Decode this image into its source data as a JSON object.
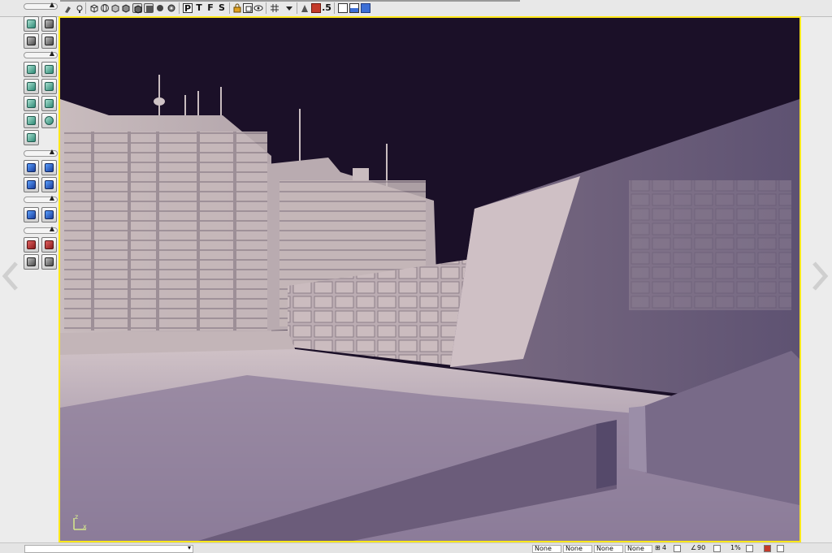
{
  "toolbar": {
    "letters": [
      "P",
      "T",
      "F",
      "S"
    ],
    "realtime_suffix": ".5",
    "icons": [
      "brush-icon",
      "lightbulb-icon",
      "wireframe-cube-icon",
      "wireframe-sphere-icon",
      "solid-cube-icon",
      "textured-cube-icon",
      "lit-cube-icon",
      "dynamic-lit-icon",
      "unlit-icon",
      "lock-icon",
      "viewport-select-icon",
      "eye-icon",
      "grid-icon",
      "dropdown-arrow-icon",
      "actor-icon",
      "realtime-preview-icon",
      "single-view-icon",
      "split-view-icon",
      "maximize-view-icon"
    ]
  },
  "tool_panel": {
    "groups": [
      {
        "tools": [
          "camera-mode-icon",
          "cube-icon",
          "terrain-icon",
          "move-axis-icon"
        ]
      },
      {
        "tools": [
          "cube-builder-icon",
          "cone-builder-icon",
          "stairs-builder-icon",
          "cylinder-builder-icon",
          "sheet-builder-icon",
          "plane-builder-icon",
          "curved-stairs-icon",
          "sphere-builder-icon",
          "volumetric-builder-icon"
        ]
      },
      {
        "tools": [
          "csg-add-icon",
          "csg-subtract-icon",
          "csg-intersect-icon",
          "csg-deintersect-icon"
        ]
      },
      {
        "tools": [
          "add-volume-icon",
          "add-mover-icon"
        ]
      },
      {
        "tools": [
          "show-selected-icon",
          "hide-selected-icon",
          "select-all-icon",
          "clear-icon"
        ]
      }
    ]
  },
  "viewport": {
    "axis_labels": {
      "x": "x",
      "z": "z"
    },
    "border_color": "#ffe81a",
    "sky_color": "#1a0f26"
  },
  "status_bar": {
    "fields": [
      "None",
      "None",
      "None",
      "None"
    ],
    "grid_value": "4",
    "rotation_value": "90",
    "scale_value": "1%"
  }
}
